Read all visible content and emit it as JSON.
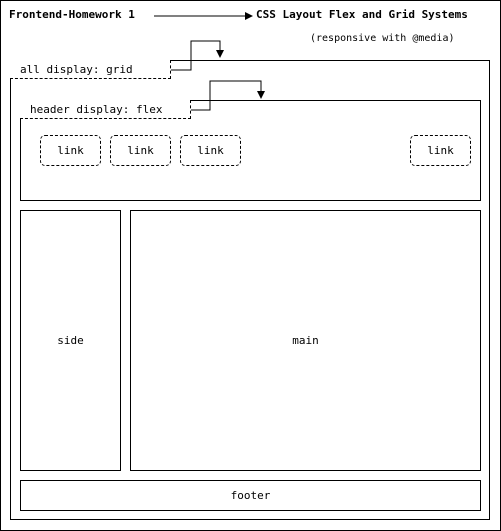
{
  "header": {
    "title_left": "Frontend-Homework 1",
    "title_right": "CSS Layout Flex and Grid Systems",
    "subtitle": "(responsive with @media)"
  },
  "grid": {
    "tag": "all display: grid"
  },
  "header_block": {
    "tag": "header display: flex",
    "links": [
      "link",
      "link",
      "link",
      "link"
    ]
  },
  "side": {
    "label": "side"
  },
  "main": {
    "label": "main"
  },
  "footer": {
    "label": "footer"
  }
}
